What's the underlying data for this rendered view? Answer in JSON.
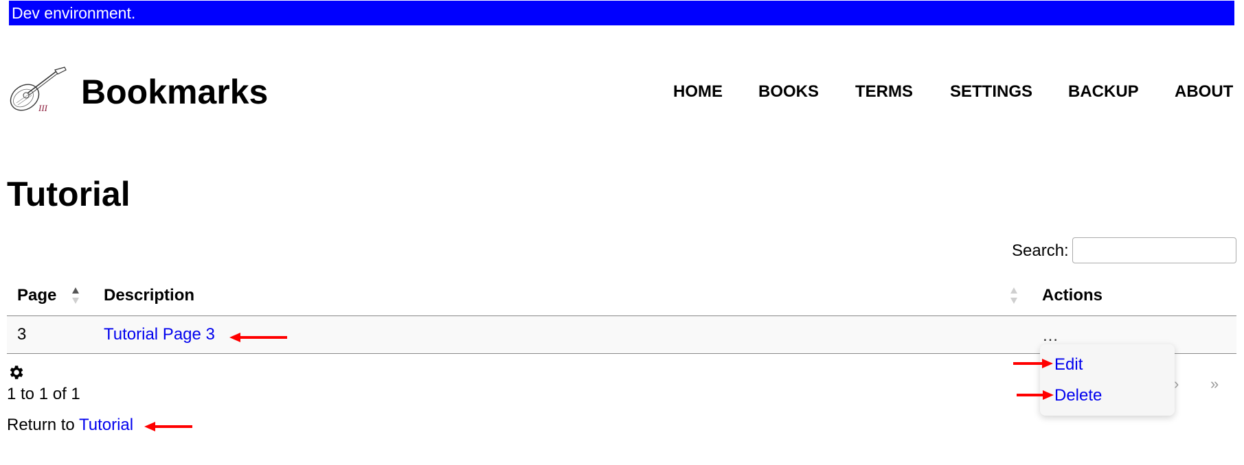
{
  "dev_banner": "Dev environment.",
  "site": {
    "title": "Bookmarks"
  },
  "nav": {
    "items": [
      {
        "label": "HOME"
      },
      {
        "label": "BOOKS"
      },
      {
        "label": "TERMS"
      },
      {
        "label": "SETTINGS"
      },
      {
        "label": "BACKUP"
      },
      {
        "label": "ABOUT"
      }
    ]
  },
  "page_title": "Tutorial",
  "search": {
    "label": "Search:",
    "value": "",
    "placeholder": ""
  },
  "table": {
    "columns": {
      "page": "Page",
      "description": "Description",
      "actions": "Actions"
    },
    "rows": [
      {
        "page": "3",
        "description": "Tutorial Page 3",
        "actions": "…"
      }
    ]
  },
  "actions_menu": {
    "items": [
      {
        "label": "Edit"
      },
      {
        "label": "Delete"
      }
    ]
  },
  "footer": {
    "info": "1 to 1 of 1",
    "return_prefix": "Return to",
    "return_link": "Tutorial"
  },
  "pagination": {
    "next": "›",
    "last": "»"
  },
  "colors": {
    "banner_bg": "#0000ff",
    "link": "#0000ee",
    "annotation_arrow": "#ff0000"
  }
}
